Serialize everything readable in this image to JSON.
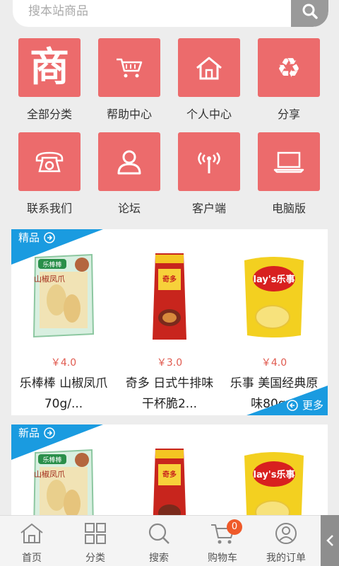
{
  "search": {
    "placeholder": "搜本站商品"
  },
  "menu": [
    {
      "label": "全部分类",
      "icon": "shop-logo-icon",
      "glyph": "商"
    },
    {
      "label": "帮助中心",
      "icon": "cart-icon"
    },
    {
      "label": "个人中心",
      "icon": "home-icon"
    },
    {
      "label": "分享",
      "icon": "recycle-share-icon"
    },
    {
      "label": "联系我们",
      "icon": "telephone-icon"
    },
    {
      "label": "论坛",
      "icon": "user-icon"
    },
    {
      "label": "客户端",
      "icon": "signal-tower-icon"
    },
    {
      "label": "电脑版",
      "icon": "laptop-icon"
    }
  ],
  "sections": [
    {
      "tag": "精品",
      "more": "更多",
      "products": [
        {
          "price": "￥4.0",
          "name": "乐棒棒 山椒凤爪70g/..."
        },
        {
          "price": "￥3.0",
          "name": "奇多 日式牛排味干杯脆2..."
        },
        {
          "price": "￥4.0",
          "name": "乐事 美国经典原味80g..."
        }
      ]
    },
    {
      "tag": "新品",
      "products": [
        {
          "price": "",
          "name": ""
        },
        {
          "price": "",
          "name": ""
        },
        {
          "price": "",
          "name": ""
        }
      ]
    }
  ],
  "product_images": {
    "chicken_feet_brand": "乐棒棒",
    "chicken_feet_title": "山椒凤爪",
    "cheetos_brand": "奇多",
    "lays_brand": "lay's乐事"
  },
  "nav": [
    {
      "label": "首页",
      "icon": "home-nav-icon"
    },
    {
      "label": "分类",
      "icon": "grid-nav-icon"
    },
    {
      "label": "搜索",
      "icon": "search-nav-icon"
    },
    {
      "label": "购物车",
      "icon": "cart-nav-icon",
      "badge": "0"
    },
    {
      "label": "我的订单",
      "icon": "user-nav-icon"
    }
  ],
  "colors": {
    "tile": "#ec6b6c",
    "ribbon": "#1a9be0",
    "price": "#e05a4f",
    "badge": "#ef5a2a"
  }
}
